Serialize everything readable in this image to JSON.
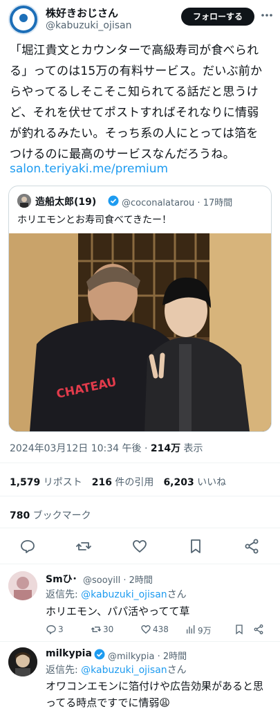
{
  "author": {
    "display_name": "株好きおじさん",
    "handle": "@kabuzuki_ojisan",
    "avatar_icon": "avatar-icon",
    "avatar_color": "#1d6fb8"
  },
  "follow_button": {
    "label": "フォローする"
  },
  "tweet": {
    "lines": [
      "「堀江貴文とカウンターで高級寿司が食べられ",
      "る」ってのは15万の有料サービス。だいぶ前か",
      "らやってるしそこそこ知られてる話だと思うけ",
      "ど、それを伏せてポストすればそれなりに情弱",
      "が釣れるみたい。そっち系の人にとっては箔を",
      "つけるのに最高のサービスなんだろうね。"
    ],
    "link": "salon.teriyaki.me/premium"
  },
  "quote": {
    "name": "造船太郎(19)",
    "handle": "@coconalatarou · 17時間",
    "text": "ホリエモンとお寿司食べてきたー！",
    "badge_color": "#1d9bf0"
  },
  "timestamp": {
    "date": "2024年03月12日 10:34 午後 · ",
    "views_count": "214万",
    "views_label": " 表示"
  },
  "stats": {
    "reposts_count": "1,579",
    "reposts_label": " リポスト",
    "quotes_count": "216",
    "quotes_label": " 件の引用",
    "likes_count": "6,203",
    "likes_label": " いいね"
  },
  "bookmarks": {
    "count": "780",
    "label": " ブックマーク"
  },
  "replies": [
    {
      "name": "Smひ･",
      "handle": "@sooyill · 2時間",
      "replying_prefix": "返信先: ",
      "replying_to": "@kabuzuki_ojisan",
      "replying_suffix": "さん",
      "text": "ホリエモン、パパ活やってて草",
      "metrics": {
        "replies": "3",
        "reposts": "30",
        "likes": "438",
        "views": "9万"
      }
    },
    {
      "name": "milkypia",
      "handle": "@milkypia · 2時間",
      "replying_prefix": "返信先: ",
      "replying_to": "@kabuzuki_ojisan",
      "replying_suffix": "さん",
      "text_lines": [
        "オワコンエモンに箔付けや広告効果があると思",
        "ってる時点ですでに情弱😩"
      ]
    }
  ],
  "colors": {
    "link": "#1d9bf0",
    "secondary": "#536471",
    "text": "#0f1419",
    "border": "#cfd9de"
  }
}
